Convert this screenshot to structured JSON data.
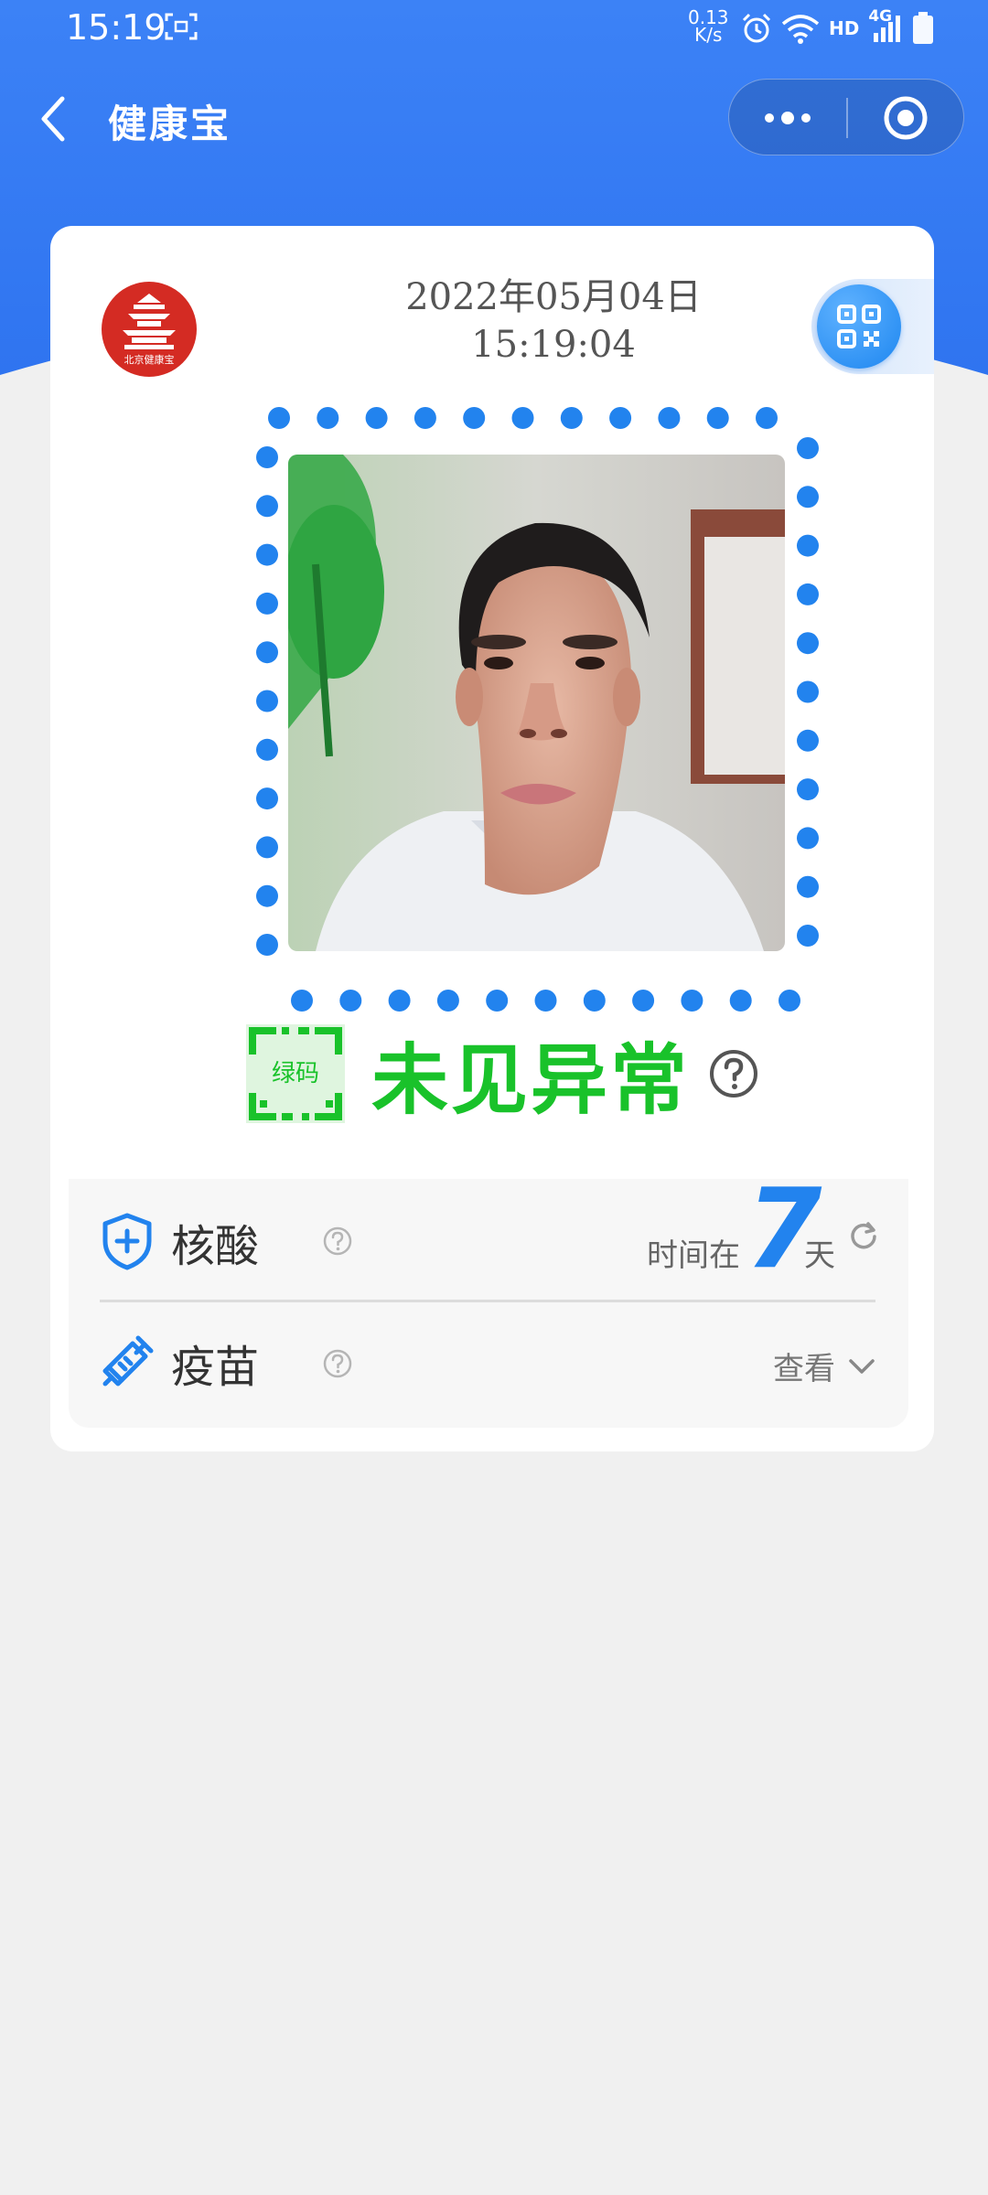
{
  "status_bar": {
    "time": "15:19",
    "net_speed_value": "0.13",
    "net_speed_unit": "K/s",
    "hd": "HD",
    "net_type": "4G"
  },
  "nav": {
    "title": "健康宝",
    "back_icon": "chevron-left-icon",
    "more_icon": "more-dots-icon",
    "close_icon": "target-close-icon"
  },
  "card": {
    "logo_text": "北京健康宝",
    "date": "2022年05月04日",
    "time": "15:19:04",
    "qr_icon": "qr-code-icon"
  },
  "health_status": {
    "code_label": "绿码",
    "text": "未见异常",
    "color": "#19c22a"
  },
  "nucleic": {
    "label": "核酸",
    "time_prefix": "时间在",
    "days": "7",
    "days_unit": "天"
  },
  "vaccine": {
    "label": "疫苗",
    "view_label": "查看"
  },
  "colors": {
    "primary_blue": "#2a7ff5",
    "accent_blue": "#2283ee",
    "green": "#19c22a",
    "logo_red": "#d42b23"
  }
}
